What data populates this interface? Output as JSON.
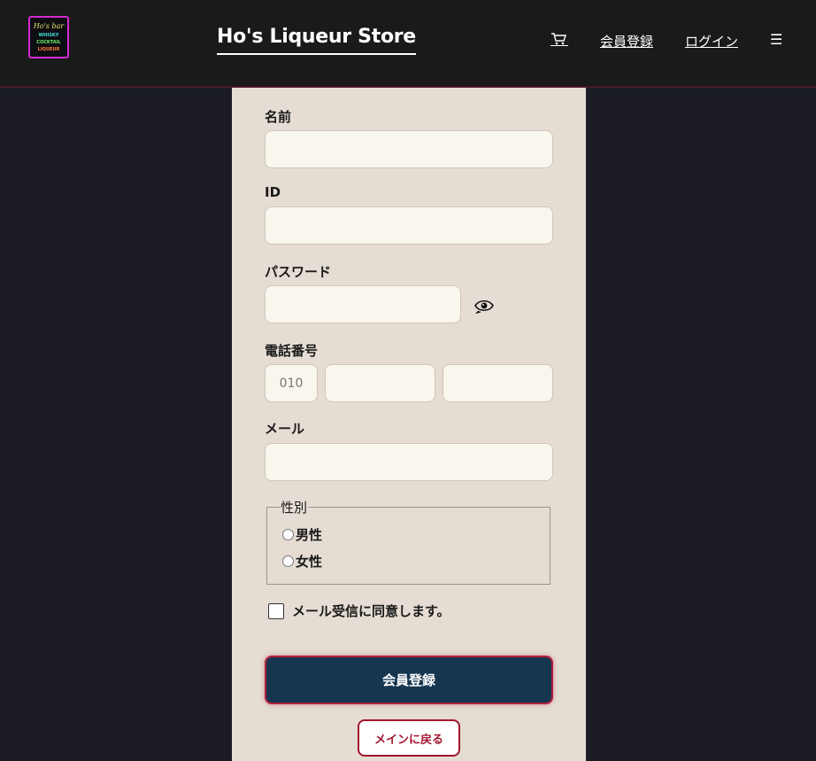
{
  "header": {
    "logo": {
      "line1": "Ho's bar",
      "line2": "WHISKY",
      "line3": "COCKTAIL",
      "line4": "LIQUEUR"
    },
    "site_title": "Ho's Liqueur Store",
    "cart_icon": "cart-icon",
    "nav_signup": "会員登録",
    "nav_login": "ログイン",
    "menu_icon": "☰"
  },
  "form": {
    "name_label": "名前",
    "id_label": "ID",
    "password_label": "パスワード",
    "phone_label": "電話番号",
    "phone_part1_placeholder": "010",
    "email_label": "メール",
    "gender_legend": "性別",
    "gender_options": [
      "男性",
      "女性"
    ],
    "agree_label": "メール受信に同意します。",
    "submit_label": "会員登録",
    "back_label": "メインに戻る"
  },
  "colors": {
    "header_bg": "#1a1a1a",
    "page_bg": "#1c1c24",
    "panel_bg": "#e5ddd3",
    "submit_bg": "#163650",
    "accent": "#b0203d"
  }
}
